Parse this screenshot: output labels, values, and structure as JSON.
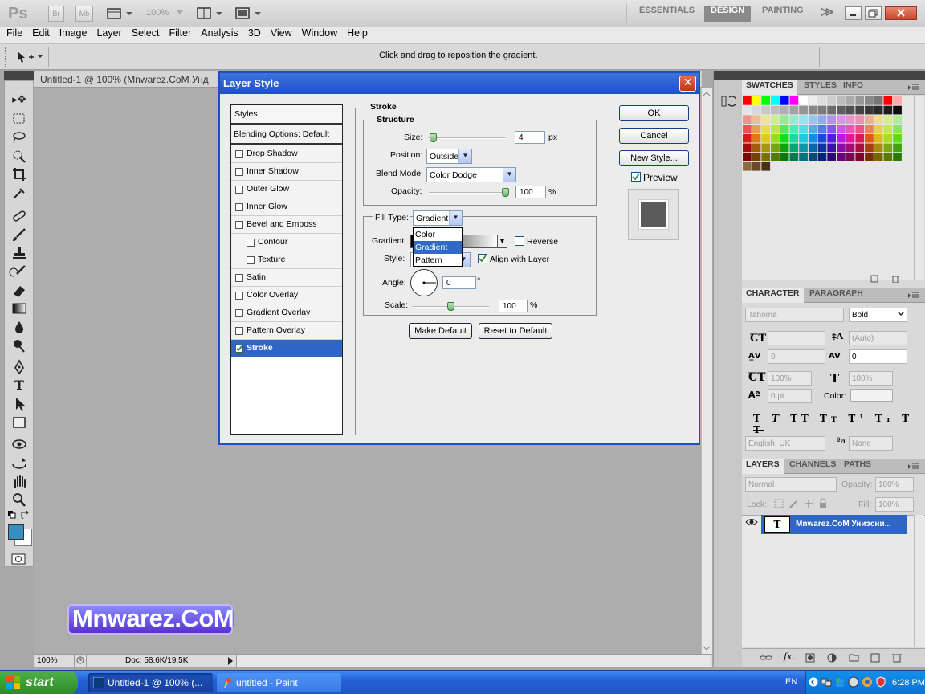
{
  "app": {
    "logo": "Ps",
    "bridge_btn": "Br",
    "minibridge_btn": "Mb",
    "zoom": "100%",
    "workspaces": [
      "ESSENTIALS",
      "DESIGN",
      "PAINTING"
    ],
    "active_workspace": "DESIGN",
    "more_glyph": "≫"
  },
  "menu": [
    "File",
    "Edit",
    "Image",
    "Layer",
    "Select",
    "Filter",
    "Analysis",
    "3D",
    "View",
    "Window",
    "Help"
  ],
  "options": {
    "hint": "Click and drag to reposition the gradient."
  },
  "document": {
    "tab_title": "Untitled-1 @ 100% (Mnwarez.CoM Унд",
    "status_zoom": "100%",
    "status_doc": "Doc: 58.6K/19.5K"
  },
  "dialog": {
    "title": "Layer Style",
    "styles_header": "Styles",
    "blending_options": "Blending Options: Default",
    "effects": [
      {
        "label": "Drop Shadow",
        "checked": false,
        "indent": false
      },
      {
        "label": "Inner Shadow",
        "checked": false,
        "indent": false
      },
      {
        "label": "Outer Glow",
        "checked": false,
        "indent": false
      },
      {
        "label": "Inner Glow",
        "checked": false,
        "indent": false
      },
      {
        "label": "Bevel and Emboss",
        "checked": false,
        "indent": false
      },
      {
        "label": "Contour",
        "checked": false,
        "indent": true
      },
      {
        "label": "Texture",
        "checked": false,
        "indent": true
      },
      {
        "label": "Satin",
        "checked": false,
        "indent": false
      },
      {
        "label": "Color Overlay",
        "checked": false,
        "indent": false
      },
      {
        "label": "Gradient Overlay",
        "checked": false,
        "indent": false
      },
      {
        "label": "Pattern Overlay",
        "checked": false,
        "indent": false
      },
      {
        "label": "Stroke",
        "checked": true,
        "indent": false,
        "selected": true
      }
    ],
    "stroke": {
      "section": "Stroke",
      "structure": "Structure",
      "size_label": "Size:",
      "size_value": "4",
      "size_unit": "px",
      "size_level": 0.02,
      "position_label": "Position:",
      "position_value": "Outside",
      "blend_label": "Blend Mode:",
      "blend_value": "Color Dodge",
      "opacity_label": "Opacity:",
      "opacity_value": "100",
      "opacity_unit": "%",
      "opacity_level": 1.0,
      "fill_type_label": "Fill Type:",
      "fill_type_value": "Gradient",
      "fill_type_options": [
        "Color",
        "Gradient",
        "Pattern"
      ],
      "gradient_label": "Gradient:",
      "reverse_label": "Reverse",
      "reverse_checked": false,
      "style_label": "Style:",
      "align_label": "Align with Layer",
      "align_checked": true,
      "angle_label": "Angle:",
      "angle_value": "0",
      "angle_unit": "°",
      "scale_label": "Scale:",
      "scale_value": "100",
      "scale_unit": "%",
      "scale_level": 0.5,
      "make_default": "Make Default",
      "reset_default": "Reset to Default"
    },
    "ok": "OK",
    "cancel": "Cancel",
    "new_style": "New Style...",
    "preview_label": "Preview",
    "preview_checked": true
  },
  "panels": {
    "swatches_tabs": [
      "SWATCHES",
      "STYLES",
      "INFO"
    ],
    "character_tabs": [
      "CHARACTER",
      "PARAGRAPH"
    ],
    "font_family": "Tahoma",
    "font_style": "Bold",
    "leading": "(Auto)",
    "kerning": "0",
    "tracking": "0",
    "vscale": "100%",
    "hscale": "100%",
    "baseline": "0 pt",
    "color_label": "Color:",
    "language": "English: UK",
    "antialias": "None",
    "layers_tabs": [
      "LAYERS",
      "CHANNELS",
      "PATHS"
    ],
    "blend_mode": "Normal",
    "opacity_label": "Opacity:",
    "opacity_value": "100%",
    "lock_label": "Lock:",
    "fill_label": "Fill:",
    "fill_value": "100%",
    "layer_name": "Mnwarez.CoM Униэсни...",
    "layer_thumb": "T"
  },
  "watermark": "Mnwarez.CoM",
  "taskbar": {
    "start": "start",
    "tasks": [
      "Untitled-1 @ 100% (...",
      "untitled - Paint"
    ],
    "lang": "EN",
    "time": "6:28 PM"
  },
  "colors": {
    "accent": "#2f66c6",
    "title_bar": "#1d4fc6",
    "foreground": "#3a8fc0",
    "taskbar": "#2460d8"
  }
}
